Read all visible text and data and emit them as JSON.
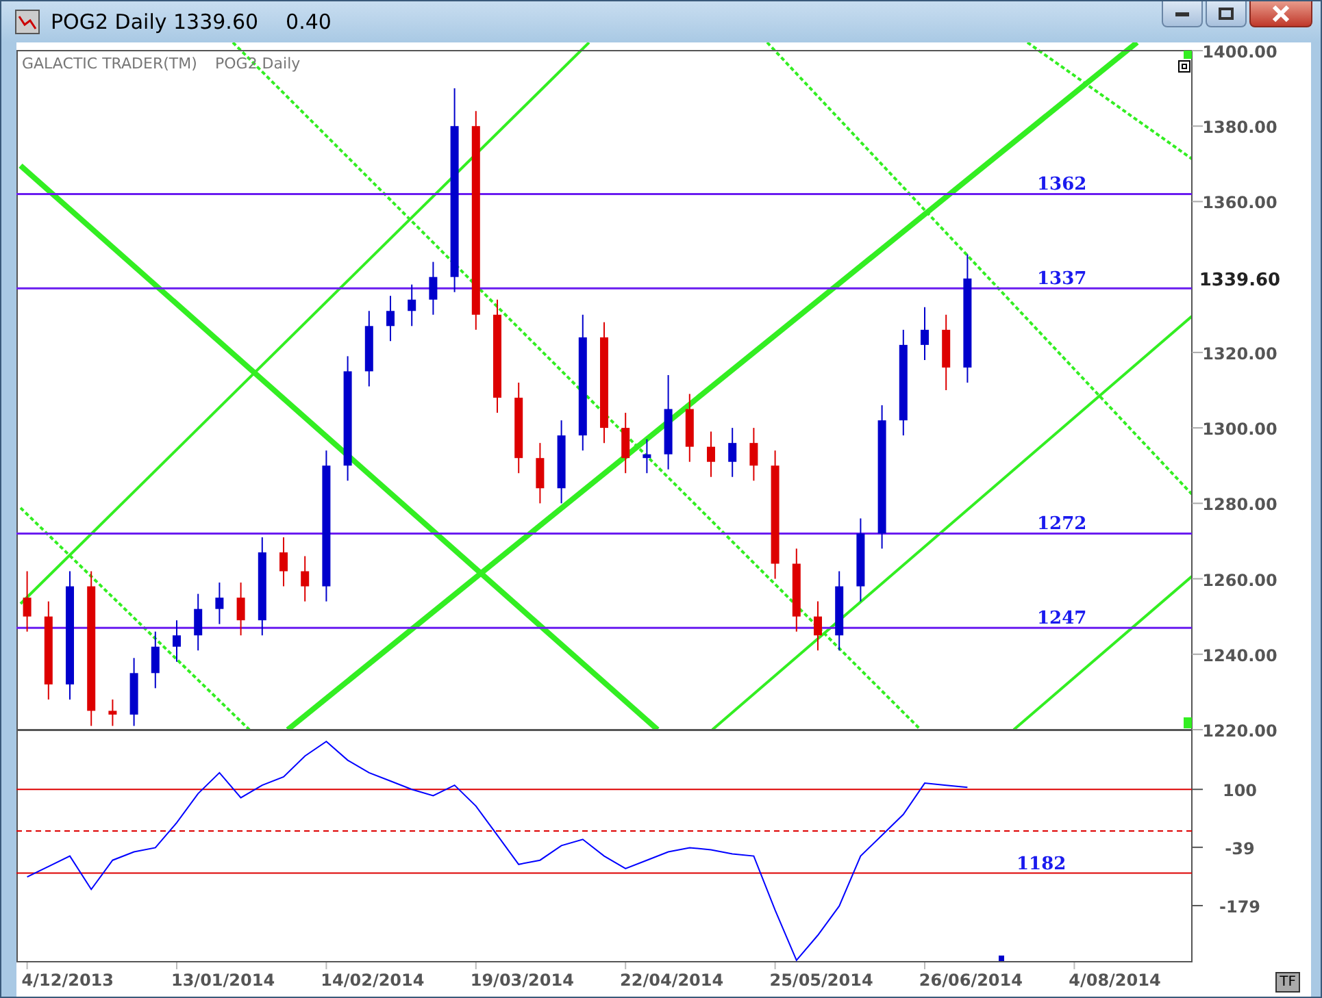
{
  "window": {
    "title": "POG2 Daily 1339.60",
    "change": "0.40"
  },
  "chart_header": {
    "brand": "GALACTIC TRADER(TM)"
  },
  "price_panel": {
    "current_price": "1339.60",
    "chart_data": {
      "type": "candlestick",
      "title": "POG2 Daily",
      "categories": [
        null,
        null,
        null,
        null,
        null,
        null,
        null,
        null,
        null,
        null,
        null,
        null,
        null,
        null,
        null,
        null,
        null,
        null,
        null,
        null,
        null,
        null,
        null,
        null,
        null,
        null,
        null,
        null,
        null,
        null,
        null,
        null,
        null,
        null,
        null,
        null,
        null,
        null,
        null,
        null,
        null,
        null,
        null,
        null,
        null,
        null,
        null,
        null,
        null,
        null,
        null,
        null,
        null,
        null,
        null
      ],
      "ohlc": [
        [
          1255,
          1262,
          1246,
          1250
        ],
        [
          1250,
          1254,
          1228,
          1232
        ],
        [
          1232,
          1262,
          1228,
          1258
        ],
        [
          1258,
          1262,
          1221,
          1225
        ],
        [
          1225,
          1228,
          1221,
          1224
        ],
        [
          1224,
          1239,
          1221,
          1235
        ],
        [
          1235,
          1246,
          1231,
          1242
        ],
        [
          1242,
          1249,
          1238,
          1245
        ],
        [
          1245,
          1256,
          1241,
          1252
        ],
        [
          1252,
          1259,
          1248,
          1255
        ],
        [
          1255,
          1259,
          1245,
          1249
        ],
        [
          1249,
          1271,
          1245,
          1267
        ],
        [
          1267,
          1271,
          1258,
          1262
        ],
        [
          1262,
          1266,
          1254,
          1258
        ],
        [
          1258,
          1294,
          1254,
          1290
        ],
        [
          1290,
          1319,
          1286,
          1315
        ],
        [
          1315,
          1331,
          1311,
          1327
        ],
        [
          1327,
          1335,
          1323,
          1331
        ],
        [
          1331,
          1338,
          1327,
          1334
        ],
        [
          1334,
          1344,
          1330,
          1340
        ],
        [
          1340,
          1390,
          1336,
          1380
        ],
        [
          1380,
          1384,
          1326,
          1330
        ],
        [
          1330,
          1334,
          1304,
          1308
        ],
        [
          1308,
          1312,
          1288,
          1292
        ],
        [
          1292,
          1296,
          1280,
          1284
        ],
        [
          1284,
          1302,
          1280,
          1298
        ],
        [
          1298,
          1330,
          1294,
          1324
        ],
        [
          1324,
          1328,
          1296,
          1300
        ],
        [
          1300,
          1304,
          1288,
          1292
        ],
        [
          1292,
          1297,
          1288,
          1293
        ],
        [
          1293,
          1314,
          1289,
          1305
        ],
        [
          1305,
          1309,
          1291,
          1295
        ],
        [
          1295,
          1299,
          1287,
          1291
        ],
        [
          1291,
          1300,
          1287,
          1296
        ],
        [
          1296,
          1300,
          1286,
          1290
        ],
        [
          1290,
          1294,
          1260,
          1264
        ],
        [
          1264,
          1268,
          1246,
          1250
        ],
        [
          1250,
          1254,
          1241,
          1245
        ],
        [
          1245,
          1262,
          1241,
          1258
        ],
        [
          1258,
          1276,
          1254,
          1272
        ],
        [
          1272,
          1306,
          1268,
          1302
        ],
        [
          1302,
          1326,
          1298,
          1322
        ],
        [
          1322,
          1332,
          1318,
          1326
        ],
        [
          1326,
          1330,
          1310,
          1316
        ],
        [
          1316,
          1346,
          1312,
          1339.6
        ],
        null,
        null,
        null,
        null,
        null,
        null,
        null,
        null,
        null,
        null
      ],
      "ylim": [
        1220,
        1400
      ],
      "yticks": [
        {
          "value": 1400,
          "label": "1400.00"
        },
        {
          "value": 1380,
          "label": "1380.00"
        },
        {
          "value": 1360,
          "label": "1360.00"
        },
        {
          "value": 1320,
          "label": "1320.00"
        },
        {
          "value": 1300,
          "label": "1300.00"
        },
        {
          "value": 1280,
          "label": "1280.00"
        },
        {
          "value": 1260,
          "label": "1260.00"
        },
        {
          "value": 1240,
          "label": "1240.00"
        },
        {
          "value": 1220,
          "label": "1220.00"
        }
      ],
      "ref_lines": [
        {
          "axis": "y",
          "value": 1362,
          "label": "1362"
        },
        {
          "axis": "y",
          "value": 1337,
          "label": "1337"
        },
        {
          "axis": "y",
          "value": 1272,
          "label": "1272"
        },
        {
          "axis": "y",
          "value": 1247,
          "label": "1247"
        }
      ]
    }
  },
  "indicator_panel": {
    "chart_data": {
      "type": "line",
      "values": [
        -110,
        -85,
        -60,
        -140,
        -70,
        -50,
        -40,
        20,
        90,
        140,
        80,
        110,
        130,
        180,
        215,
        170,
        140,
        120,
        100,
        85,
        110,
        60,
        -10,
        -80,
        -70,
        -35,
        -20,
        -60,
        -90,
        -70,
        -50,
        -40,
        -45,
        -55,
        -60,
        -190,
        -310,
        -250,
        -180,
        -60,
        -10,
        40,
        115,
        110,
        105,
        null,
        null,
        null,
        null,
        null,
        null,
        null,
        null,
        null,
        null
      ],
      "ylim": [
        -312,
        240
      ],
      "yticks": [
        100,
        -39,
        -179
      ],
      "ref_lines": [
        {
          "axis": "y",
          "value": 100
        },
        {
          "axis": "y",
          "value": 0
        },
        {
          "axis": "y",
          "value": -101
        }
      ],
      "annotations": [
        "1182"
      ]
    }
  },
  "date_axis": {
    "labels": [
      "4/12/2013",
      "13/01/2014",
      "14/02/2014",
      "19/03/2014",
      "22/04/2014",
      "25/05/2014",
      "26/06/2014",
      "4/08/2014"
    ]
  },
  "tf_button": "TF"
}
